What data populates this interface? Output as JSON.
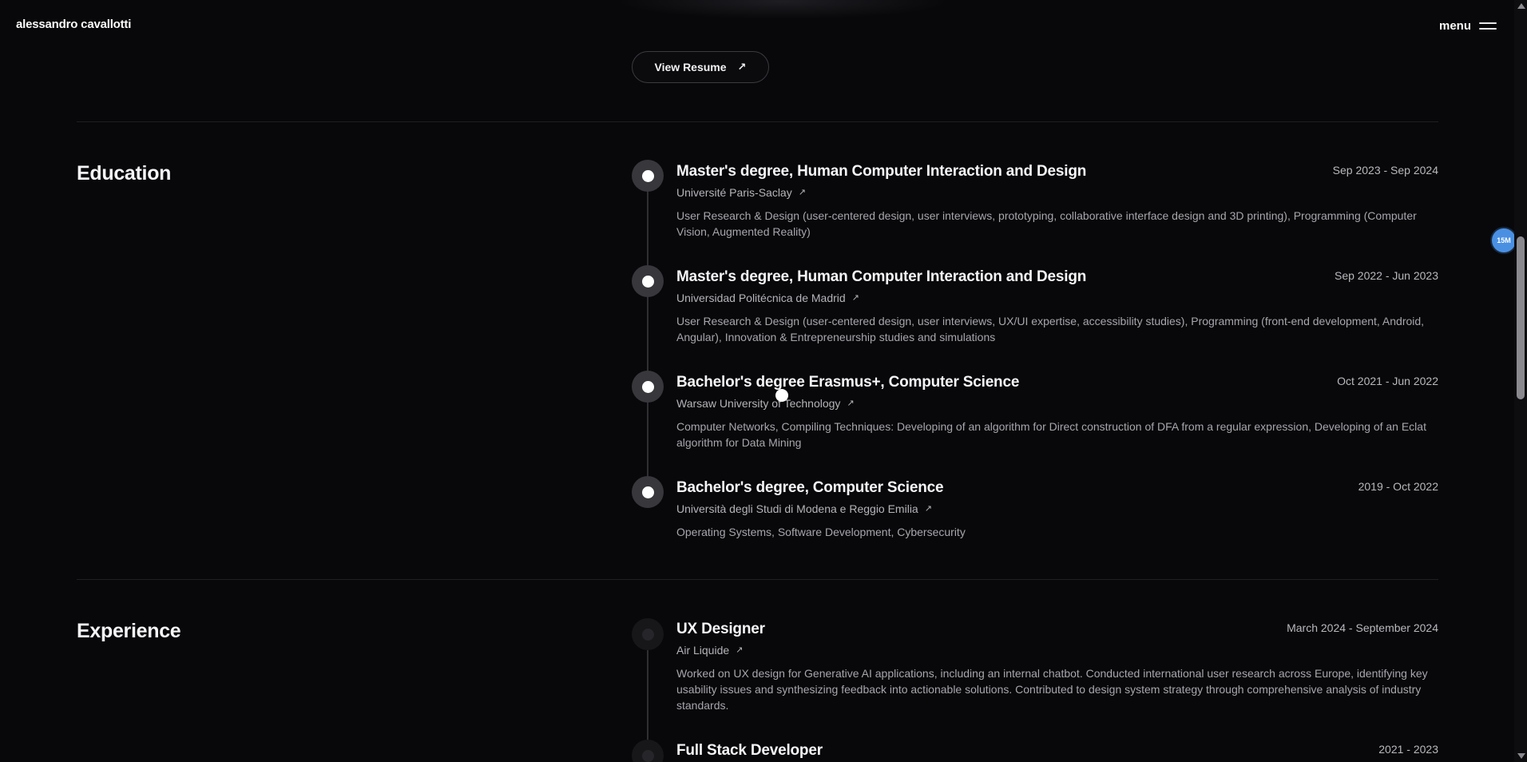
{
  "header": {
    "brand": "alessandro cavallotti",
    "menu_label": "menu"
  },
  "resume": {
    "label": "View Resume",
    "arrow": "↗"
  },
  "floating_badge": {
    "label": "15M",
    "color": "#4a90e2"
  },
  "education": {
    "title": "Education",
    "items": [
      {
        "title": "Master's degree, Human Computer Interaction and Design",
        "org": "Université Paris-Saclay",
        "date": "Sep 2023 - Sep 2024",
        "desc": "User Research & Design (user-centered design, user interviews, prototyping, collaborative interface design and 3D printing), Programming (Computer Vision, Augmented Reality)"
      },
      {
        "title": "Master's degree, Human Computer Interaction and Design",
        "org": "Universidad Politécnica de Madrid",
        "date": "Sep 2022 - Jun 2023",
        "desc": "User Research & Design (user-centered design, user interviews, UX/UI expertise, accessibility studies), Programming (front-end development, Android, Angular), Innovation & Entrepreneurship studies and simulations"
      },
      {
        "title": "Bachelor's degree Erasmus+, Computer Science",
        "org": "Warsaw University of Technology",
        "date": "Oct 2021 - Jun 2022",
        "desc": "Computer Networks, Compiling Techniques: Developing of an algorithm for Direct construction of DFA from a regular expression, Developing of an Eclat algorithm for Data Mining"
      },
      {
        "title": "Bachelor's degree, Computer Science",
        "org": "Università degli Studi di Modena e Reggio Emilia",
        "date": "2019 - Oct 2022",
        "desc": "Operating Systems, Software Development, Cybersecurity"
      }
    ]
  },
  "experience": {
    "title": "Experience",
    "items": [
      {
        "title": "UX Designer",
        "org": "Air Liquide",
        "date": "March 2024 - September 2024",
        "desc": "Worked on UX design for Generative AI applications, including an internal chatbot. Conducted international user research across Europe, identifying key usability issues and synthesizing feedback into actionable solutions. Contributed to design system strategy through comprehensive analysis of industry standards."
      },
      {
        "title": "Full Stack Developer",
        "date": "2021 - 2023"
      }
    ]
  },
  "org_arrow": "↗"
}
